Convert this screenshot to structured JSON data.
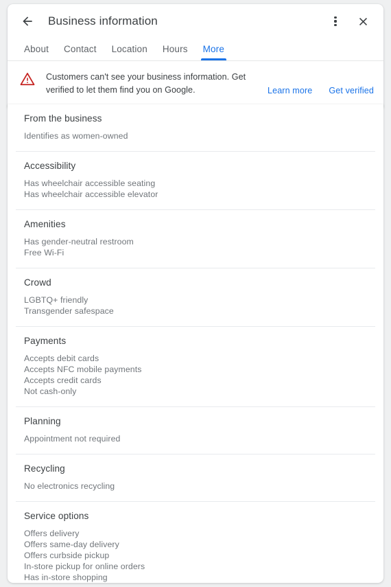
{
  "header": {
    "back_icon": "arrow-back-icon",
    "title": "Business information",
    "overflow_icon": "more-vert-icon",
    "close_icon": "close-icon"
  },
  "tabs": [
    {
      "label": "About",
      "active": false
    },
    {
      "label": "Contact",
      "active": false
    },
    {
      "label": "Location",
      "active": false
    },
    {
      "label": "Hours",
      "active": false
    },
    {
      "label": "More",
      "active": true
    }
  ],
  "banner": {
    "icon": "warning-triangle-icon",
    "message": "Customers can't see your business information. Get verified to let them find you on Google.",
    "learn_more_label": "Learn more",
    "get_verified_label": "Get verified"
  },
  "colors": {
    "accent_blue": "#1a73e8",
    "warning_red": "#c5221f",
    "heading_gray": "#3c4043",
    "body_gray": "#70757a",
    "divider": "#e8eaed"
  },
  "sections": [
    {
      "title": "From the business",
      "items": [
        "Identifies as women-owned"
      ]
    },
    {
      "title": "Accessibility",
      "items": [
        "Has wheelchair accessible seating",
        "Has wheelchair accessible elevator"
      ]
    },
    {
      "title": "Amenities",
      "items": [
        "Has gender-neutral restroom",
        "Free Wi-Fi"
      ]
    },
    {
      "title": "Crowd",
      "items": [
        "LGBTQ+ friendly",
        "Transgender safespace"
      ]
    },
    {
      "title": "Payments",
      "items": [
        "Accepts debit cards",
        "Accepts NFC mobile payments",
        "Accepts credit cards",
        "Not cash-only"
      ]
    },
    {
      "title": "Planning",
      "items": [
        "Appointment not required"
      ]
    },
    {
      "title": "Recycling",
      "items": [
        "No electronics recycling"
      ]
    },
    {
      "title": "Service options",
      "items": [
        "Offers delivery",
        "Offers same-day delivery",
        "Offers curbside pickup",
        "In-store pickup for online orders",
        "Has in-store shopping"
      ]
    }
  ]
}
